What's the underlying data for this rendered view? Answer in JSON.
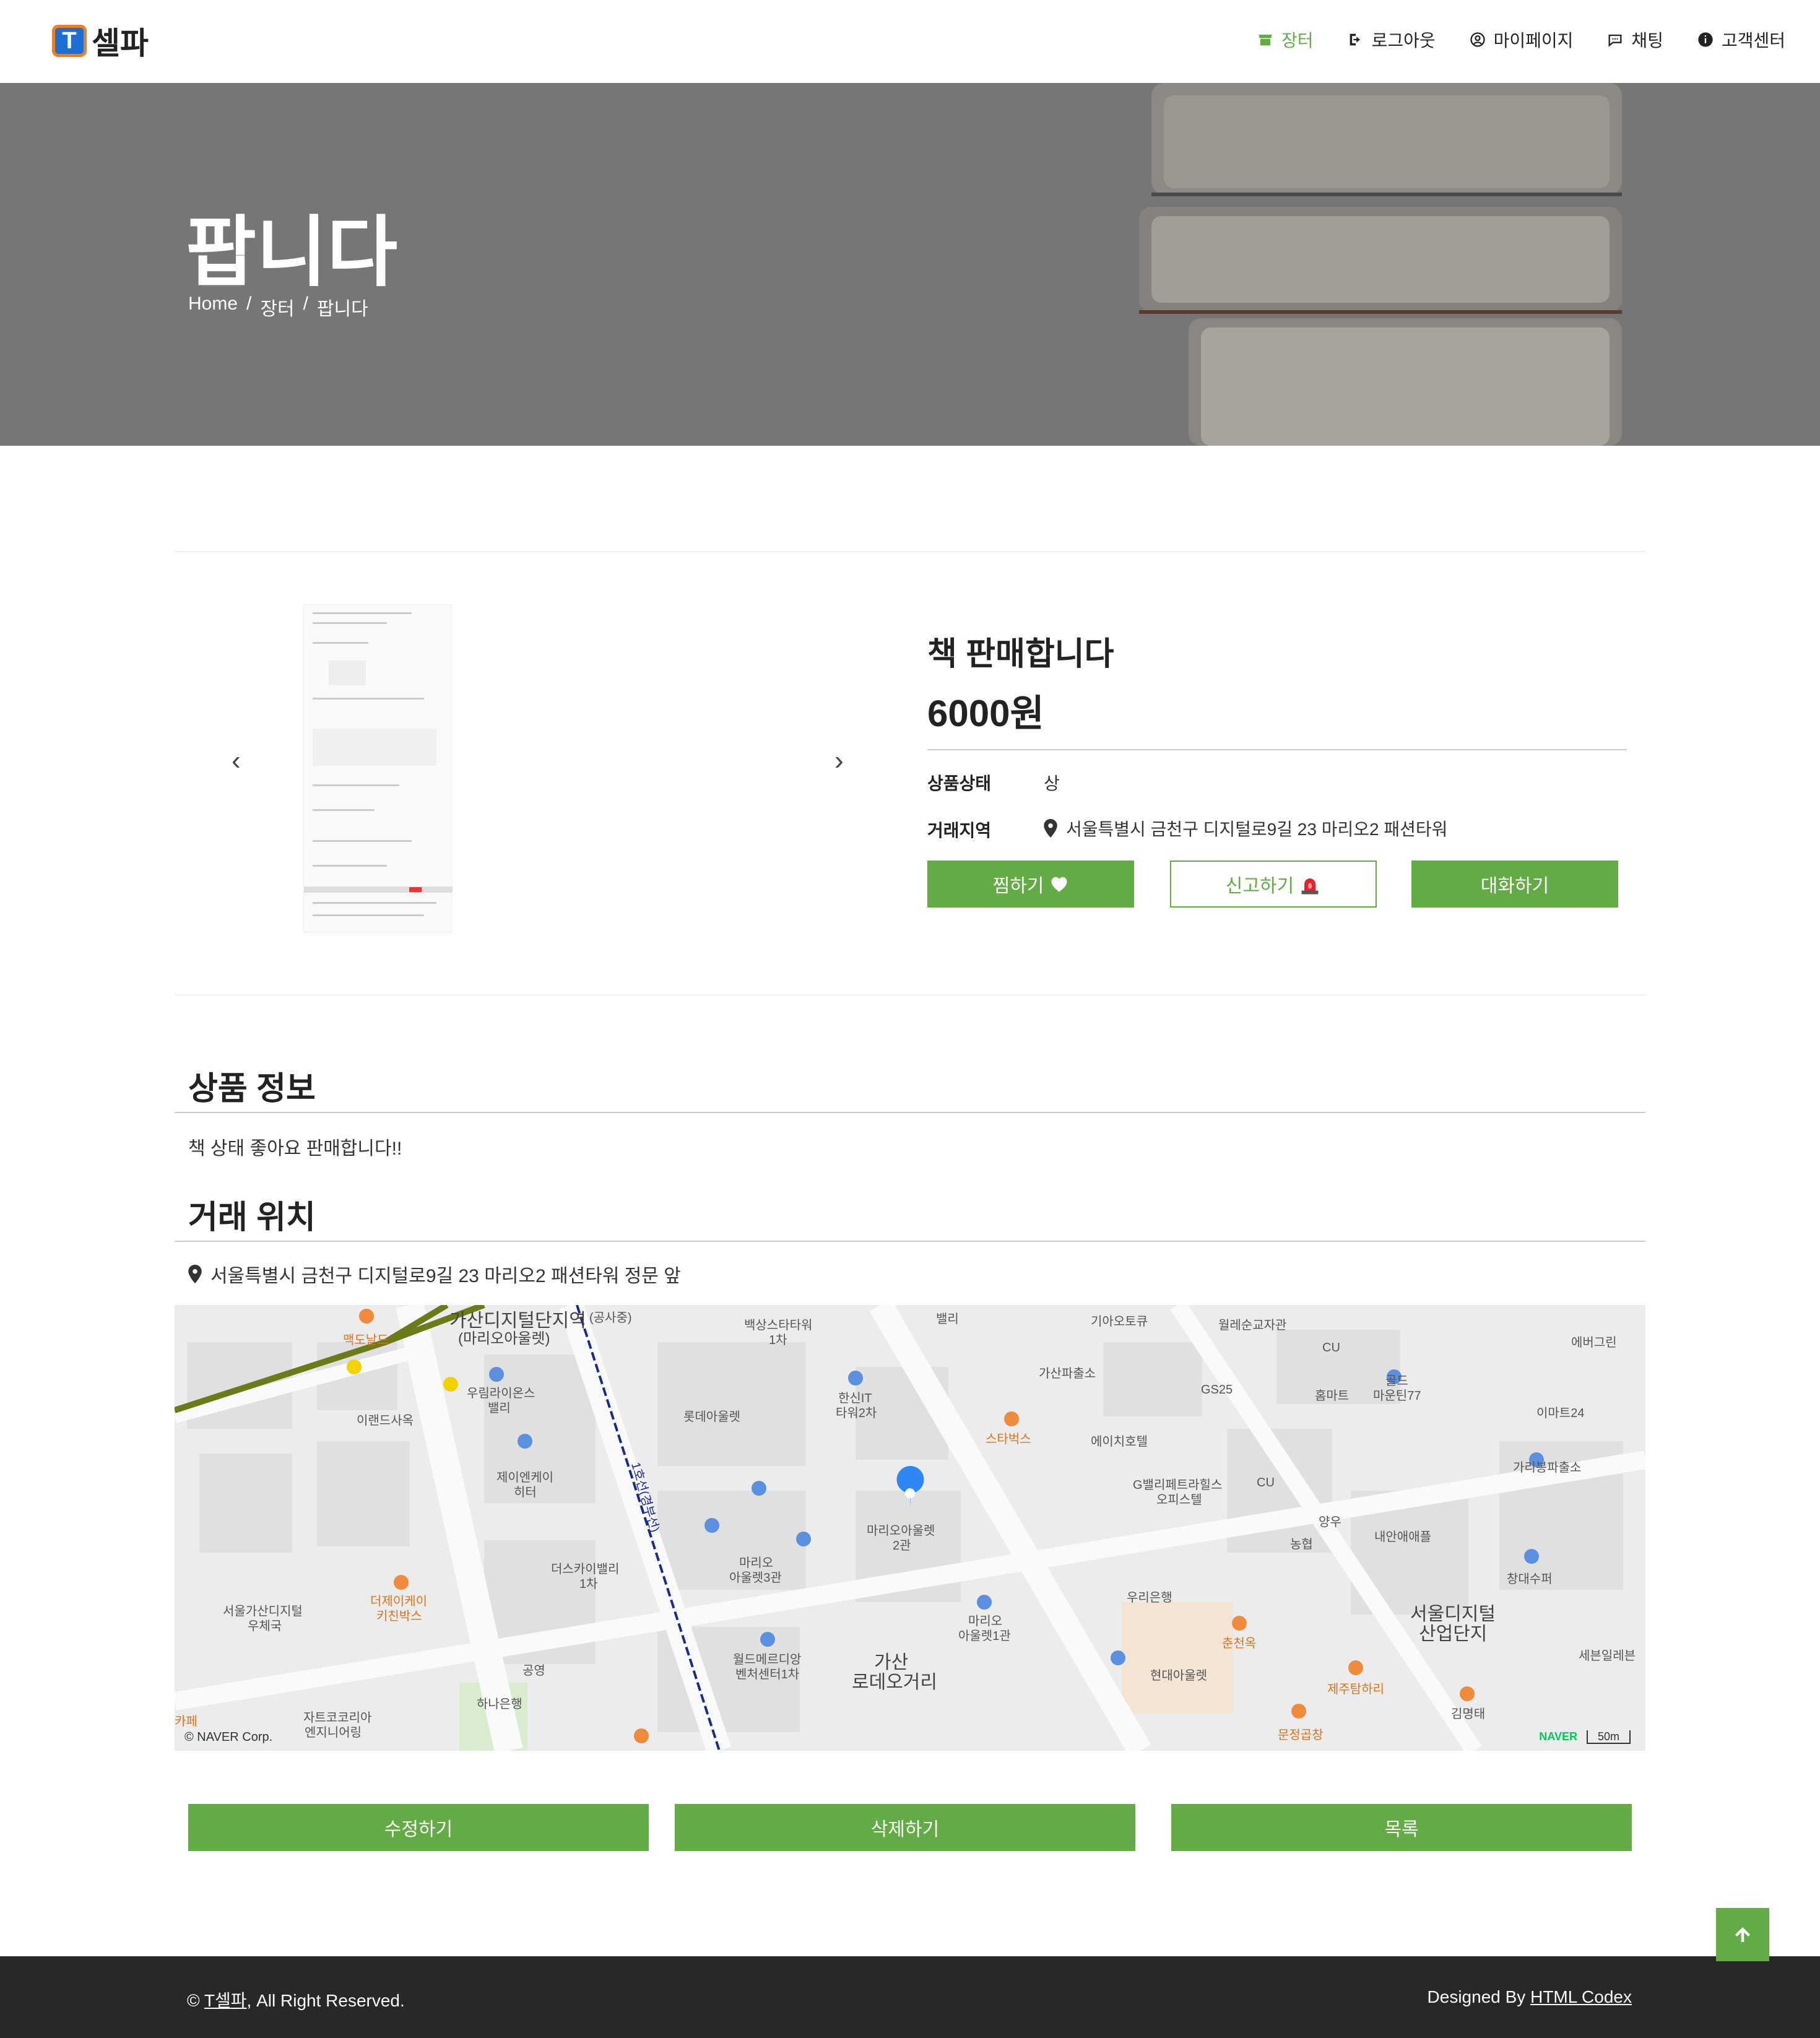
{
  "brand": {
    "logo_letter": "T",
    "name": "셀파"
  },
  "nav": {
    "items": [
      {
        "label": "장터",
        "icon": "store-icon"
      },
      {
        "label": "로그아웃",
        "icon": "logout-icon"
      },
      {
        "label": "마이페이지",
        "icon": "user-circle-icon"
      },
      {
        "label": "채팅",
        "icon": "chat-icon"
      },
      {
        "label": "고객센터",
        "icon": "info-icon"
      }
    ]
  },
  "hero": {
    "title": "팝니다",
    "breadcrumb": [
      "Home",
      "/",
      "장터",
      "/",
      "팝니다"
    ]
  },
  "product": {
    "title": "책 판매합니다",
    "price": "6000원",
    "condition_label": "상품상태",
    "condition_value": "상",
    "area_label": "거래지역",
    "area_value": "서울특별시 금천구 디지털로9길 23 마리오2 패션타워",
    "wish_button": "찜하기",
    "report_button": "신고하기",
    "chat_button": "대화하기"
  },
  "info": {
    "title": "상품 정보",
    "text": "책 상태 좋아요 판매합니다!!"
  },
  "location": {
    "title": "거래 위치",
    "address": "서울특별시 금천구 디지털로9길 23 마리오2 패션타워 정문 앞"
  },
  "map": {
    "labels": [
      "가산디지털단지역",
      "(마리오아울렛)",
      "(공사중)",
      "백상스타타워",
      "1차",
      "밸리",
      "기아오토큐",
      "월레순교자관",
      "CU",
      "에버그린",
      "맥도날드",
      "우림라이온스",
      "밸리",
      "한신IT",
      "타워2차",
      "롯데아울렛",
      "가산파출소",
      "GS25",
      "홈마트",
      "골드",
      "마운틴77",
      "이마트24",
      "이랜드사옥",
      "스타벅스",
      "에이치호텔",
      "가리봉파출소",
      "제이엔케이",
      "히터",
      "G밸리페트라힐스",
      "오피스텔",
      "CU",
      "마리오아울렛",
      "2관",
      "양우",
      "내안애애플",
      "농협",
      "더스카이밸리",
      "1차",
      "창대수퍼",
      "마리오",
      "아울렛3관",
      "서울가산디지털",
      "우체국",
      "더제이케이",
      "키친박스",
      "우리은행",
      "서울디지털",
      "산업단지",
      "마리오",
      "아울렛1관",
      "월드메르디앙",
      "벤처센터1차",
      "가산",
      "로데오거리",
      "공영",
      "춘천옥",
      "현대아울렛",
      "세븐일레븐",
      "하나은행",
      "제주탐하리",
      "김명태",
      "자트코코리아",
      "엔지니어링",
      "문정곱창",
      "카페",
      "© NAVER Corp.",
      "NAVER",
      "50m",
      "1호선(경부선)"
    ]
  },
  "actions": {
    "edit": "수정하기",
    "delete": "삭제하기",
    "list": "목록"
  },
  "footer": {
    "copyright_prefix": "©",
    "copyright_link": "T셀파",
    "copyright_suffix": ", All Right Reserved.",
    "designed_prefix": "Designed By",
    "designed_link": "HTML Codex"
  },
  "colors": {
    "accent": "#63ab45",
    "hero_bg": "#777676",
    "footer_bg": "#282828",
    "logo_orange": "#f07f1d",
    "logo_blue": "#1d6fd8"
  }
}
